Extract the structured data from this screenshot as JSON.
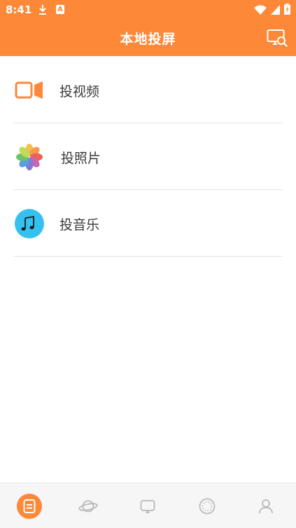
{
  "status_bar": {
    "time": "8:41",
    "badge_letter": "A",
    "icons": [
      "download-icon",
      "a-app-icon",
      "wifi-icon",
      "signal-icon",
      "battery-icon"
    ]
  },
  "header": {
    "title": "本地投屏",
    "action_icon": "screen-search-icon"
  },
  "menu": {
    "items": [
      {
        "label": "投视频",
        "icon": "video-icon"
      },
      {
        "label": "投照片",
        "icon": "photos-icon"
      },
      {
        "label": "投音乐",
        "icon": "music-icon"
      }
    ]
  },
  "bottom_nav": {
    "items": [
      {
        "icon": "document-icon",
        "active": true
      },
      {
        "icon": "planet-icon",
        "active": false
      },
      {
        "icon": "cast-icon",
        "active": false
      },
      {
        "icon": "compass-icon",
        "active": false
      },
      {
        "icon": "user-icon",
        "active": false
      }
    ]
  },
  "colors": {
    "accent": "#fd8838",
    "music_icon": "#35c1ef",
    "divider": "#e3e3e3",
    "nav_icon": "#b9b9b9"
  }
}
